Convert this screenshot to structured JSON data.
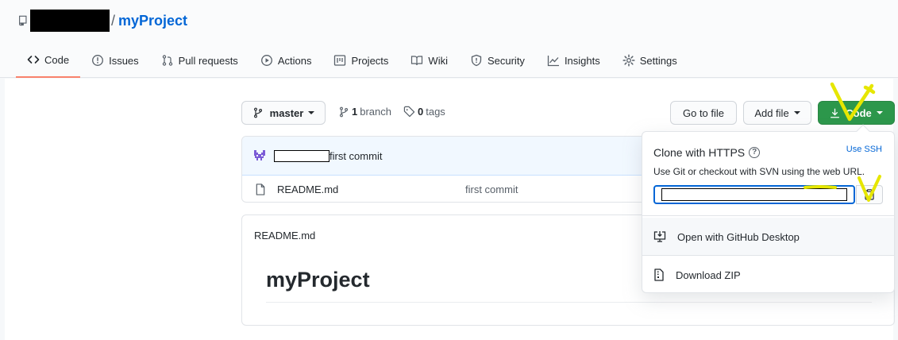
{
  "repo": {
    "name": "myProject",
    "separator": "/"
  },
  "tabs": [
    {
      "label": "Code",
      "icon": "code-icon",
      "selected": true
    },
    {
      "label": "Issues",
      "icon": "issue-icon"
    },
    {
      "label": "Pull requests",
      "icon": "pull-request-icon"
    },
    {
      "label": "Actions",
      "icon": "play-icon"
    },
    {
      "label": "Projects",
      "icon": "project-icon"
    },
    {
      "label": "Wiki",
      "icon": "book-icon"
    },
    {
      "label": "Security",
      "icon": "shield-icon"
    },
    {
      "label": "Insights",
      "icon": "graph-icon"
    },
    {
      "label": "Settings",
      "icon": "gear-icon"
    }
  ],
  "toolbar": {
    "branch_select": "master",
    "branch_count": "1",
    "branch_word": "branch",
    "tag_count": "0",
    "tag_word": "tags",
    "go_to_file": "Go to file",
    "add_file": "Add file",
    "code_button": "Code"
  },
  "commit": {
    "message": "first commit"
  },
  "files": [
    {
      "name": "README.md",
      "commit": "first commit",
      "icon": "file-icon"
    }
  ],
  "readme": {
    "label": "README.md",
    "heading": "myProject"
  },
  "clone": {
    "title": "Clone with HTTPS",
    "ssh_link": "Use SSH",
    "subtitle": "Use Git or checkout with SVN using the web URL.",
    "desktop_label": "Open with GitHub Desktop",
    "zip_label": "Download ZIP"
  },
  "colors": {
    "accent_green": "#2c974b",
    "link_blue": "#0366d6",
    "tab_underline": "#f9826c",
    "annotation_yellow": "#e6e600"
  }
}
